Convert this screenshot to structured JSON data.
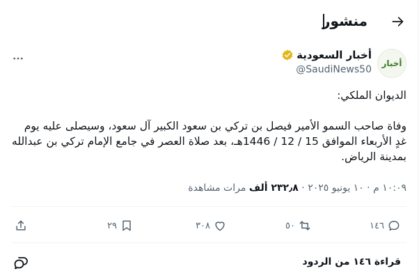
{
  "header": {
    "title": "منشور"
  },
  "author": {
    "avatar_text": "أخبار",
    "display_name": "أخبار السعودية",
    "handle": "@SaudiNews50"
  },
  "post": {
    "line1": "الديوان الملكي:",
    "line2": "وفاة صاحب السمو الأمير فيصل بن تركي بن سعود الكبير آل سعود، وسيصلى عليه يوم غدٍ الأربعاء الموافق 15 / 12 / 1446هـ، بعد صلاة العصر في جامع الإمام تركي بن عبدالله بمدينة الرياض."
  },
  "meta": {
    "time": "١٠:٠٩ م",
    "date": "١٠ يونيو ٢٠٢٥",
    "separator": "·",
    "views_count": "٢٣٢٫٨ ألف",
    "views_label": "مرات مشاهدة"
  },
  "actions": {
    "replies": "١٤٦",
    "reposts": "٥٠",
    "likes": "٣٠٨",
    "bookmarks": "٢٩"
  },
  "reply_prompt": "قراءة ١٤٦ من الردود",
  "colors": {
    "text": "#0f1419",
    "muted": "#536471",
    "verified": "#e2b719",
    "divider": "#eff3f4"
  }
}
